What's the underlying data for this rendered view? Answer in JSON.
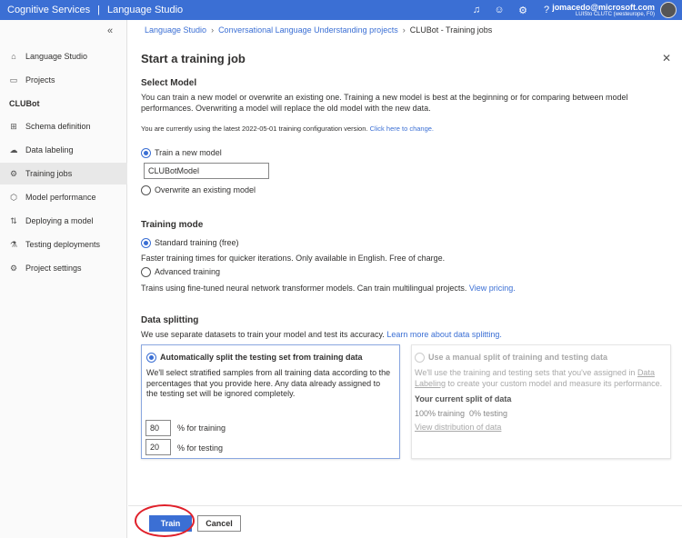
{
  "topbar": {
    "service": "Cognitive Services",
    "product": "Language Studio",
    "email": "jomacedo@microsoft.com",
    "resource": "LUISto CLUTC (westeurope, F0)"
  },
  "sidebar": {
    "collapse": "«",
    "items": [
      {
        "label": "Language Studio",
        "icon": "⌂"
      },
      {
        "label": "Projects",
        "icon": "▭"
      }
    ],
    "project": "CLUBot",
    "project_items": [
      {
        "label": "Schema definition",
        "icon": "⊞"
      },
      {
        "label": "Data labeling",
        "icon": "☁"
      },
      {
        "label": "Training jobs",
        "icon": "⚙"
      },
      {
        "label": "Model performance",
        "icon": "⬡"
      },
      {
        "label": "Deploying a model",
        "icon": "⇅"
      },
      {
        "label": "Testing deployments",
        "icon": "⚗"
      },
      {
        "label": "Project settings",
        "icon": "⚙"
      }
    ]
  },
  "breadcrumb": [
    "Language Studio",
    "Conversational Language Understanding projects",
    "CLUBot - Training jobs"
  ],
  "title": "Start a training job",
  "select_model": {
    "heading": "Select Model",
    "desc": "You can train a new model or overwrite an existing one. Training a new model is best at the beginning or for comparing between model performances. Overwriting a model will replace the old model with the new data.",
    "config_note": "You are currently using the latest 2022-05-01 training configuration version.",
    "config_link": "Click here to change.",
    "opt_new": "Train a new model",
    "model_name": "CLUBotModel",
    "opt_overwrite": "Overwrite an existing model"
  },
  "training_mode": {
    "heading": "Training mode",
    "standard": "Standard training (free)",
    "standard_desc": "Faster training times for quicker iterations. Only available in English. Free of charge.",
    "advanced": "Advanced training",
    "advanced_desc": "Trains using fine-tuned neural network transformer models. Can train multilingual projects.",
    "pricing_link": "View pricing."
  },
  "data_splitting": {
    "heading": "Data splitting",
    "desc": "We use separate datasets to train your model and test its accuracy.",
    "learn_link": "Learn more about data splitting.",
    "auto": {
      "label": "Automatically split the testing set from training data",
      "desc": "We'll select stratified samples from all training data according to the percentages that you provide here. Any data already assigned to the testing set will be ignored completely.",
      "training_pct": "80",
      "training_label": "% for training",
      "testing_pct": "20",
      "testing_label": "% for testing"
    },
    "manual": {
      "label": "Use a manual split of training and testing data",
      "desc1": "We'll use the training and testing sets that you've assigned in",
      "desc_link": "Data Labeling",
      "desc2": "to create your custom model and measure its performance.",
      "current_heading": "Your current split of data",
      "current": "100% training  0% testing",
      "view_link": "View distribution of data"
    }
  },
  "footer": {
    "train": "Train",
    "cancel": "Cancel"
  }
}
